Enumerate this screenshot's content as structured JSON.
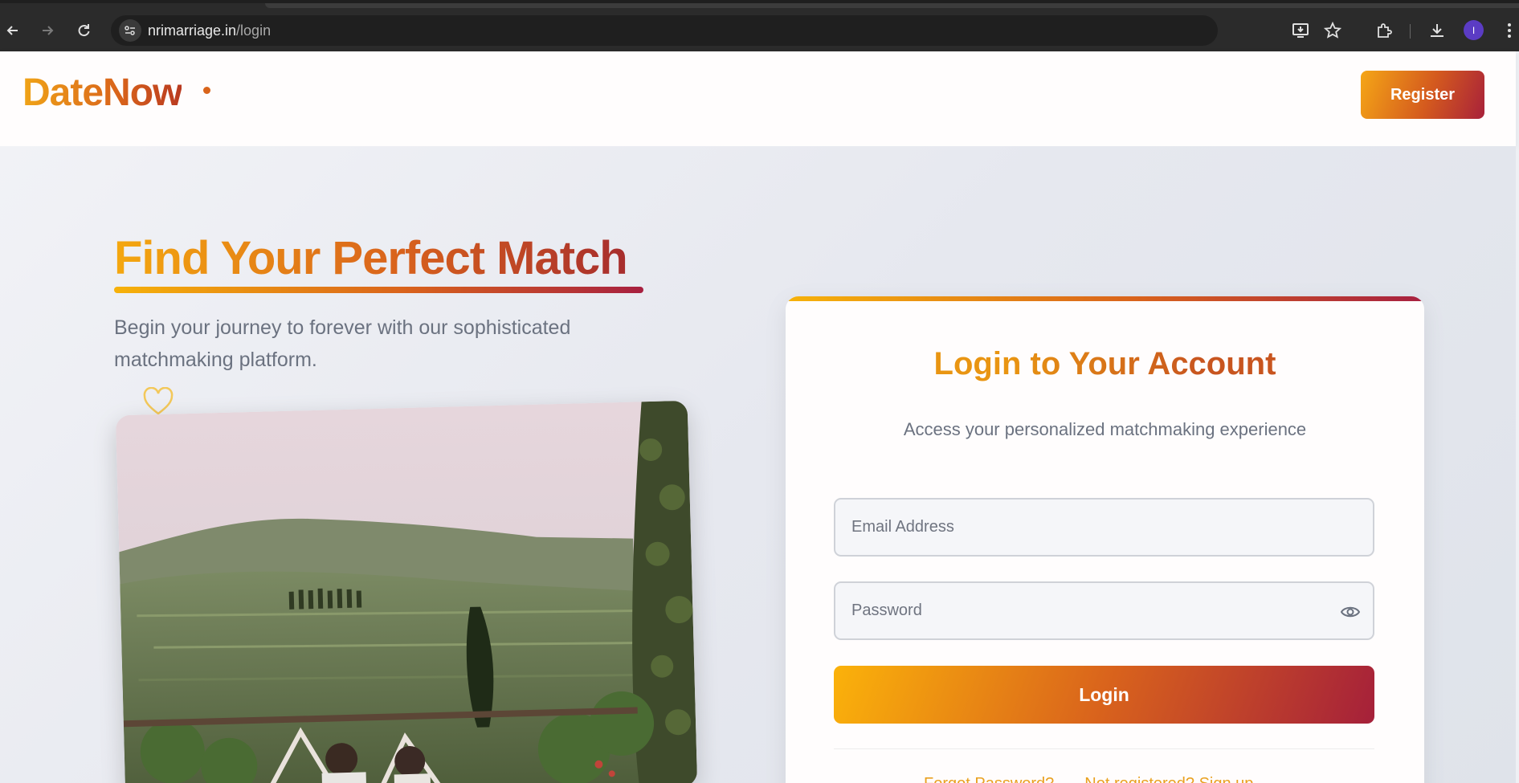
{
  "browser": {
    "url_host": "nrimarriage.in",
    "url_path": "/login",
    "avatar_letter": "I"
  },
  "header": {
    "logo": "DateNow",
    "register_label": "Register"
  },
  "hero": {
    "title": "Find Your Perfect Match",
    "subtitle": "Begin your journey to forever with our sophisticated matchmaking platform."
  },
  "login": {
    "title": "Login to Your Account",
    "subtitle": "Access your personalized matchmaking experience",
    "email_placeholder": "Email Address",
    "password_placeholder": "Password",
    "login_label": "Login",
    "forgot_label": "Forgot Password?",
    "signup_label": "Not registered? Sign up"
  },
  "colors": {
    "brand_orange": "#f0a418",
    "brand_red": "#a72040",
    "chrome_dark": "#2b2b2b"
  }
}
